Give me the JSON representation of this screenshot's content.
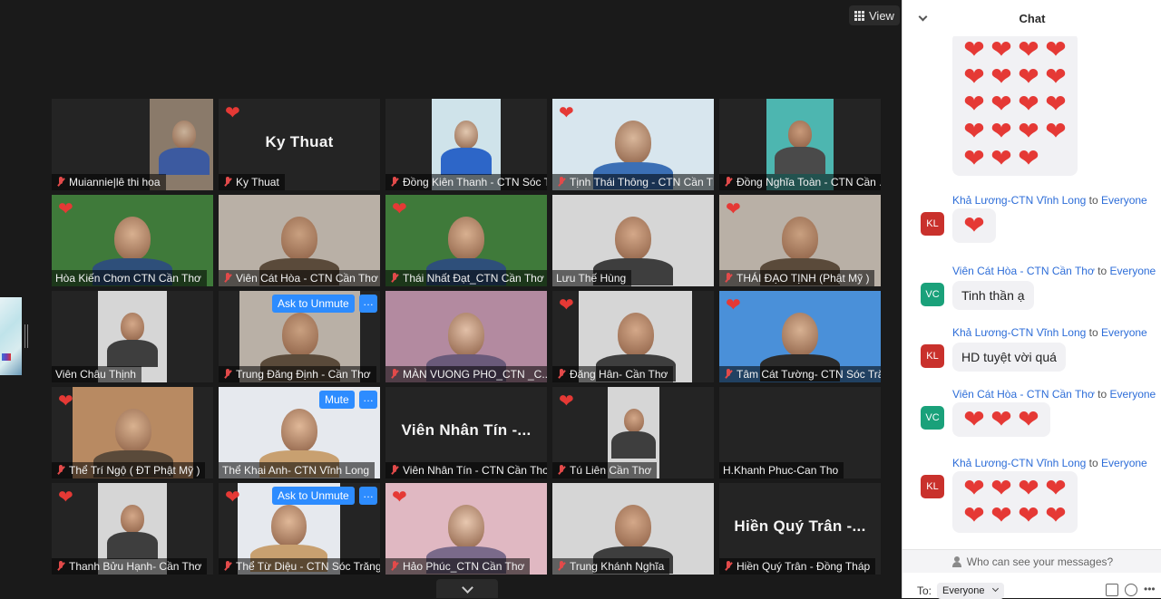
{
  "toolbar": {
    "view_label": "View"
  },
  "participants": [
    {
      "name": "Muiannie|lê thi hoa",
      "muted": true,
      "heart": false,
      "video": true,
      "tone": "boy"
    },
    {
      "name": "Ky Thuat",
      "muted": true,
      "heart": true,
      "video": false,
      "big": "Ky Thuat"
    },
    {
      "name": "Đồng Kiên Thanh - CTN Sóc Trăng",
      "display": "Đồng Kiên Thanh - CTN Sóc Tră...",
      "muted": true,
      "heart": false,
      "video": true,
      "tone": "blue"
    },
    {
      "name": "Tịnh Thái Thông - CTN Cần Thơ",
      "muted": true,
      "heart": true,
      "video": true,
      "tone": "balloon"
    },
    {
      "name": "Đồng Nghĩa Toàn - CTN Cần Thơ",
      "display": "Đồng Nghĩa Toàn - CTN Cần ...",
      "muted": true,
      "heart": false,
      "video": true,
      "tone": "teal"
    },
    {
      "name": "Hòa Kiến Chơn CTN Cần Thơ",
      "muted": false,
      "heart": true,
      "video": true,
      "tone": "forest",
      "active": true
    },
    {
      "name": "Viên Cát Hòa - CTN Cần Thơ",
      "muted": true,
      "heart": false,
      "video": true,
      "tone": "room"
    },
    {
      "name": "Thái Nhất Đạt_CTN Cần Thơ",
      "muted": true,
      "heart": true,
      "video": true,
      "tone": "forest"
    },
    {
      "name": "Lưu Thế Hùng",
      "muted": false,
      "heart": false,
      "video": true,
      "tone": "grey"
    },
    {
      "name": "THÁI ĐẠO TỊNH (Phật Mỹ )",
      "muted": true,
      "heart": true,
      "video": true,
      "tone": "room"
    },
    {
      "name": "Viên Châu Thịnh",
      "muted": false,
      "heart": false,
      "video": true,
      "tone": "grey"
    },
    {
      "name": "Trung Đăng Định - Cần Thơ",
      "muted": true,
      "heart": false,
      "video": true,
      "tone": "room",
      "pill": "Ask to Unmute"
    },
    {
      "name": "MÀN VUONG PHO_CTN _C...",
      "muted": true,
      "heart": false,
      "video": true,
      "tone": "pink"
    },
    {
      "name": "Đăng Hân- Cần Thơ",
      "muted": true,
      "heart": true,
      "video": true,
      "tone": "grey"
    },
    {
      "name": "Tâm Cát Tường- CTN Sóc Trăng",
      "display": "Tâm Cát Tường- CTN Sóc Tră...",
      "muted": true,
      "heart": true,
      "video": true,
      "tone": "sky"
    },
    {
      "name": "Thể Trí Ngộ ( ĐT Phật Mỹ )",
      "muted": true,
      "heart": true,
      "video": true,
      "tone": "brown"
    },
    {
      "name": "Thể Khai Anh- CTN Vĩnh Long",
      "muted": false,
      "heart": false,
      "video": true,
      "tone": "pattern",
      "pill": "Mute"
    },
    {
      "name": "Viên Nhân Tín - CTN Cần Thơ",
      "muted": true,
      "heart": false,
      "video": false,
      "big": "Viên Nhân Tín -..."
    },
    {
      "name": "Tú Liên Cần Thơ",
      "muted": true,
      "heart": true,
      "video": true,
      "tone": "grey"
    },
    {
      "name": "H.Khanh Phuc-Can Tho",
      "muted": false,
      "heart": false,
      "video": false,
      "big": ""
    },
    {
      "name": "Thanh Bửu Hạnh- Cần Thơ",
      "muted": true,
      "heart": true,
      "video": true,
      "tone": "grey"
    },
    {
      "name": "Thể Từ Diệu - CTN Sóc Trăng",
      "muted": true,
      "heart": true,
      "video": true,
      "tone": "pattern",
      "pill": "Ask to Unmute"
    },
    {
      "name": "Hảo Phúc_CTN Cần Thơ",
      "muted": true,
      "heart": true,
      "video": true,
      "tone": "pinkwall"
    },
    {
      "name": "Trung Khánh Nghĩa",
      "muted": true,
      "heart": false,
      "video": true,
      "tone": "grey"
    },
    {
      "name": "Hiền Quý Trân - Đồng Tháp",
      "muted": true,
      "heart": false,
      "video": false,
      "big": "Hiền Quý Trân -..."
    }
  ],
  "chat": {
    "title": "Chat",
    "top_hearts_rows": [
      4,
      4,
      4,
      4,
      3
    ],
    "messages": [
      {
        "sender": "Khả Lương-CTN Vĩnh Long",
        "to": "to",
        "recipient": "Everyone",
        "initials": "KL",
        "type": "hearts",
        "rows": [
          1
        ]
      },
      {
        "sender": "Viên Cát Hòa - CTN Cần Thơ",
        "to": "to",
        "recipient": "Everyone",
        "initials": "VC",
        "type": "text",
        "text": "Tinh thần ạ"
      },
      {
        "sender": "Khả Lương-CTN Vĩnh Long",
        "to": "to",
        "recipient": "Everyone",
        "initials": "KL",
        "type": "text",
        "text": "HD tuyệt vời quá"
      },
      {
        "sender": "Viên Cát Hòa - CTN Cần Thơ",
        "to": "to",
        "recipient": "Everyone",
        "initials": "VC",
        "type": "hearts",
        "rows": [
          3
        ]
      },
      {
        "sender": "Khả Lương-CTN Vĩnh Long",
        "to": "to",
        "recipient": "Everyone",
        "initials": "KL",
        "type": "hearts",
        "rows": [
          4,
          4
        ]
      }
    ],
    "privacy_text": "Who can see your messages?",
    "to_label": "To:",
    "to_value": "Everyone"
  },
  "colors": {
    "heart": "#e53935",
    "active_speaker": "#d9dd6c",
    "link_blue": "#2d6dd8",
    "pill_blue": "#2d8cff"
  }
}
